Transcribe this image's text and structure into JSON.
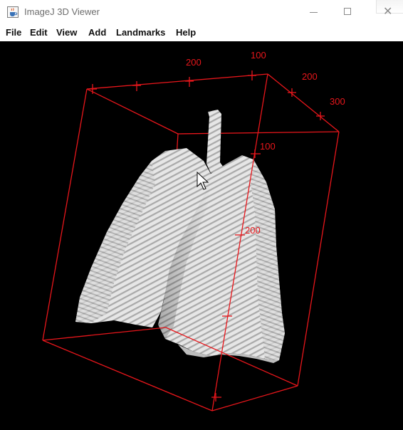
{
  "window": {
    "title": "ImageJ 3D Viewer",
    "close_glyph": "✕"
  },
  "menu": {
    "items": [
      "File",
      "Edit",
      "View",
      "Add",
      "Landmarks",
      "Help"
    ]
  },
  "viewer": {
    "background": "#000000",
    "bounding_box_color": "#e8161b",
    "surface_color": "#e4e4e4",
    "axis_labels": {
      "top_200": "200",
      "top_100": "100",
      "right_200": "200",
      "right_300": "300",
      "vertical_100": "100",
      "vertical_200": "200"
    }
  },
  "icons": {
    "app": "java-coffee-cup-icon",
    "minimize": "minimize-icon",
    "maximize": "maximize-icon",
    "close": "close-icon",
    "cursor": "mouse-pointer-icon"
  }
}
